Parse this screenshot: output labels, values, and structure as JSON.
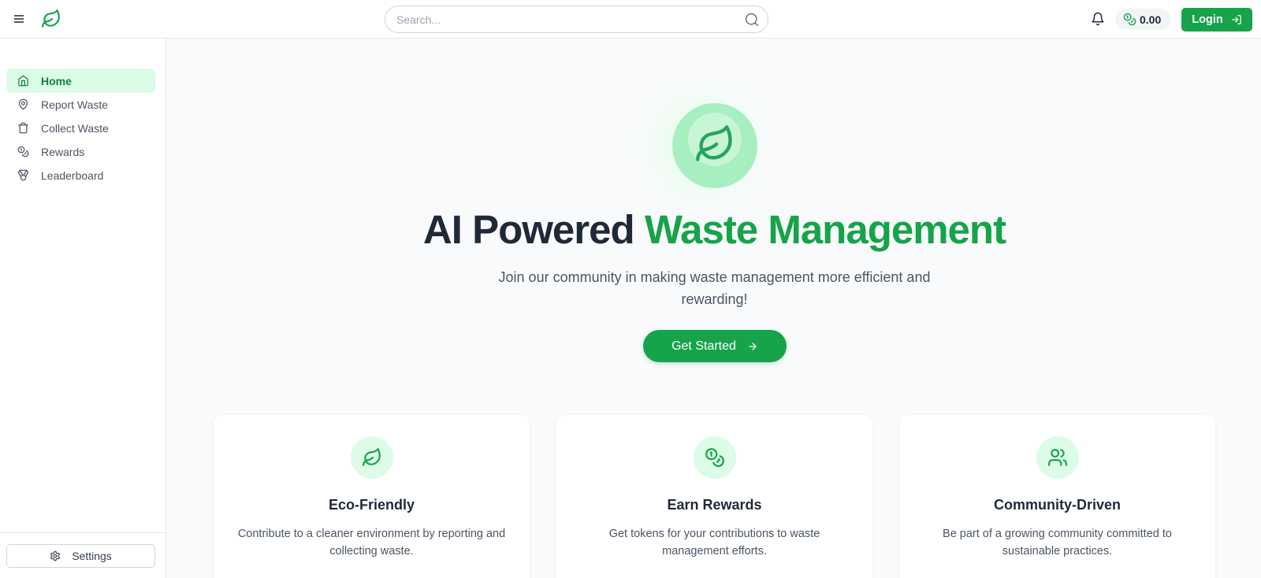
{
  "header": {
    "search_placeholder": "Search...",
    "balance": "0.00",
    "login_label": "Login"
  },
  "sidebar": {
    "items": [
      {
        "label": "Home",
        "icon": "home-icon",
        "active": true
      },
      {
        "label": "Report Waste",
        "icon": "map-pin-icon"
      },
      {
        "label": "Collect Waste",
        "icon": "trash-icon"
      },
      {
        "label": "Rewards",
        "icon": "coins-icon"
      },
      {
        "label": "Leaderboard",
        "icon": "medal-icon"
      }
    ],
    "settings_label": "Settings"
  },
  "hero": {
    "title_dark": "AI Powered",
    "title_green": "Waste Management",
    "subtitle": "Join our community in making waste management more efficient and rewarding!",
    "cta_label": "Get Started"
  },
  "features": [
    {
      "title": "Eco-Friendly",
      "desc": "Contribute to a cleaner environment by reporting and collecting waste.",
      "icon": "leaf-icon"
    },
    {
      "title": "Earn Rewards",
      "desc": "Get tokens for your contributions to waste management efforts.",
      "icon": "coins-icon"
    },
    {
      "title": "Community-Driven",
      "desc": "Be part of a growing community committed to sustainable practices.",
      "icon": "users-icon"
    }
  ],
  "colors": {
    "accent": "#16a34a",
    "accent_light": "#dcfce7",
    "text_dark": "#1f2937"
  }
}
